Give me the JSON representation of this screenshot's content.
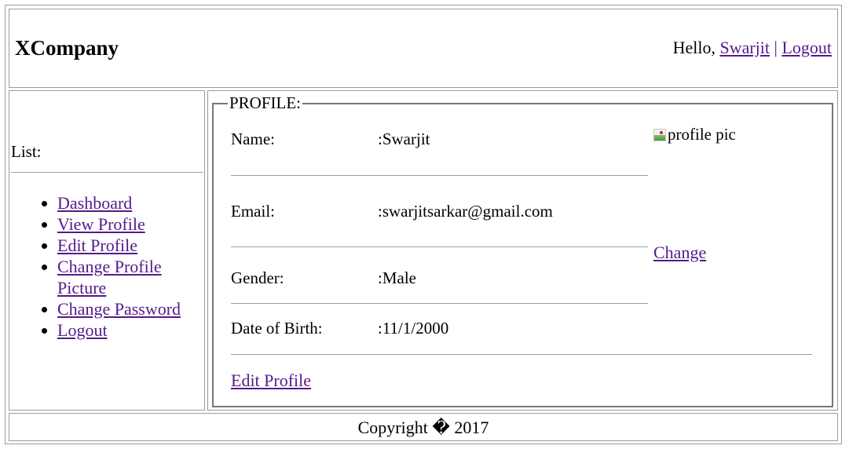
{
  "header": {
    "brand": "XCompany",
    "greeting": "Hello,",
    "user": "Swarjit",
    "separator": "|",
    "logout": "Logout"
  },
  "sidebar": {
    "title": "List:",
    "items": [
      {
        "label": "Dashboard"
      },
      {
        "label": "View Profile"
      },
      {
        "label": "Edit Profile"
      },
      {
        "label": "Change Profile Picture"
      },
      {
        "label": "Change Password"
      },
      {
        "label": "Logout"
      }
    ]
  },
  "profile": {
    "legend": "PROFILE:",
    "fields": [
      {
        "label": "Name:",
        "value": ":Swarjit"
      },
      {
        "label": "Email:",
        "value": ":swarjitsarkar@gmail.com"
      },
      {
        "label": "Gender:",
        "value": ":Male"
      },
      {
        "label": "Date of Birth:",
        "value": ":11/1/2000"
      }
    ],
    "picture_alt": "profile pic",
    "change_label": "Change",
    "edit_label": "Edit Profile"
  },
  "footer": {
    "copyright": "Copyright � 2017"
  }
}
